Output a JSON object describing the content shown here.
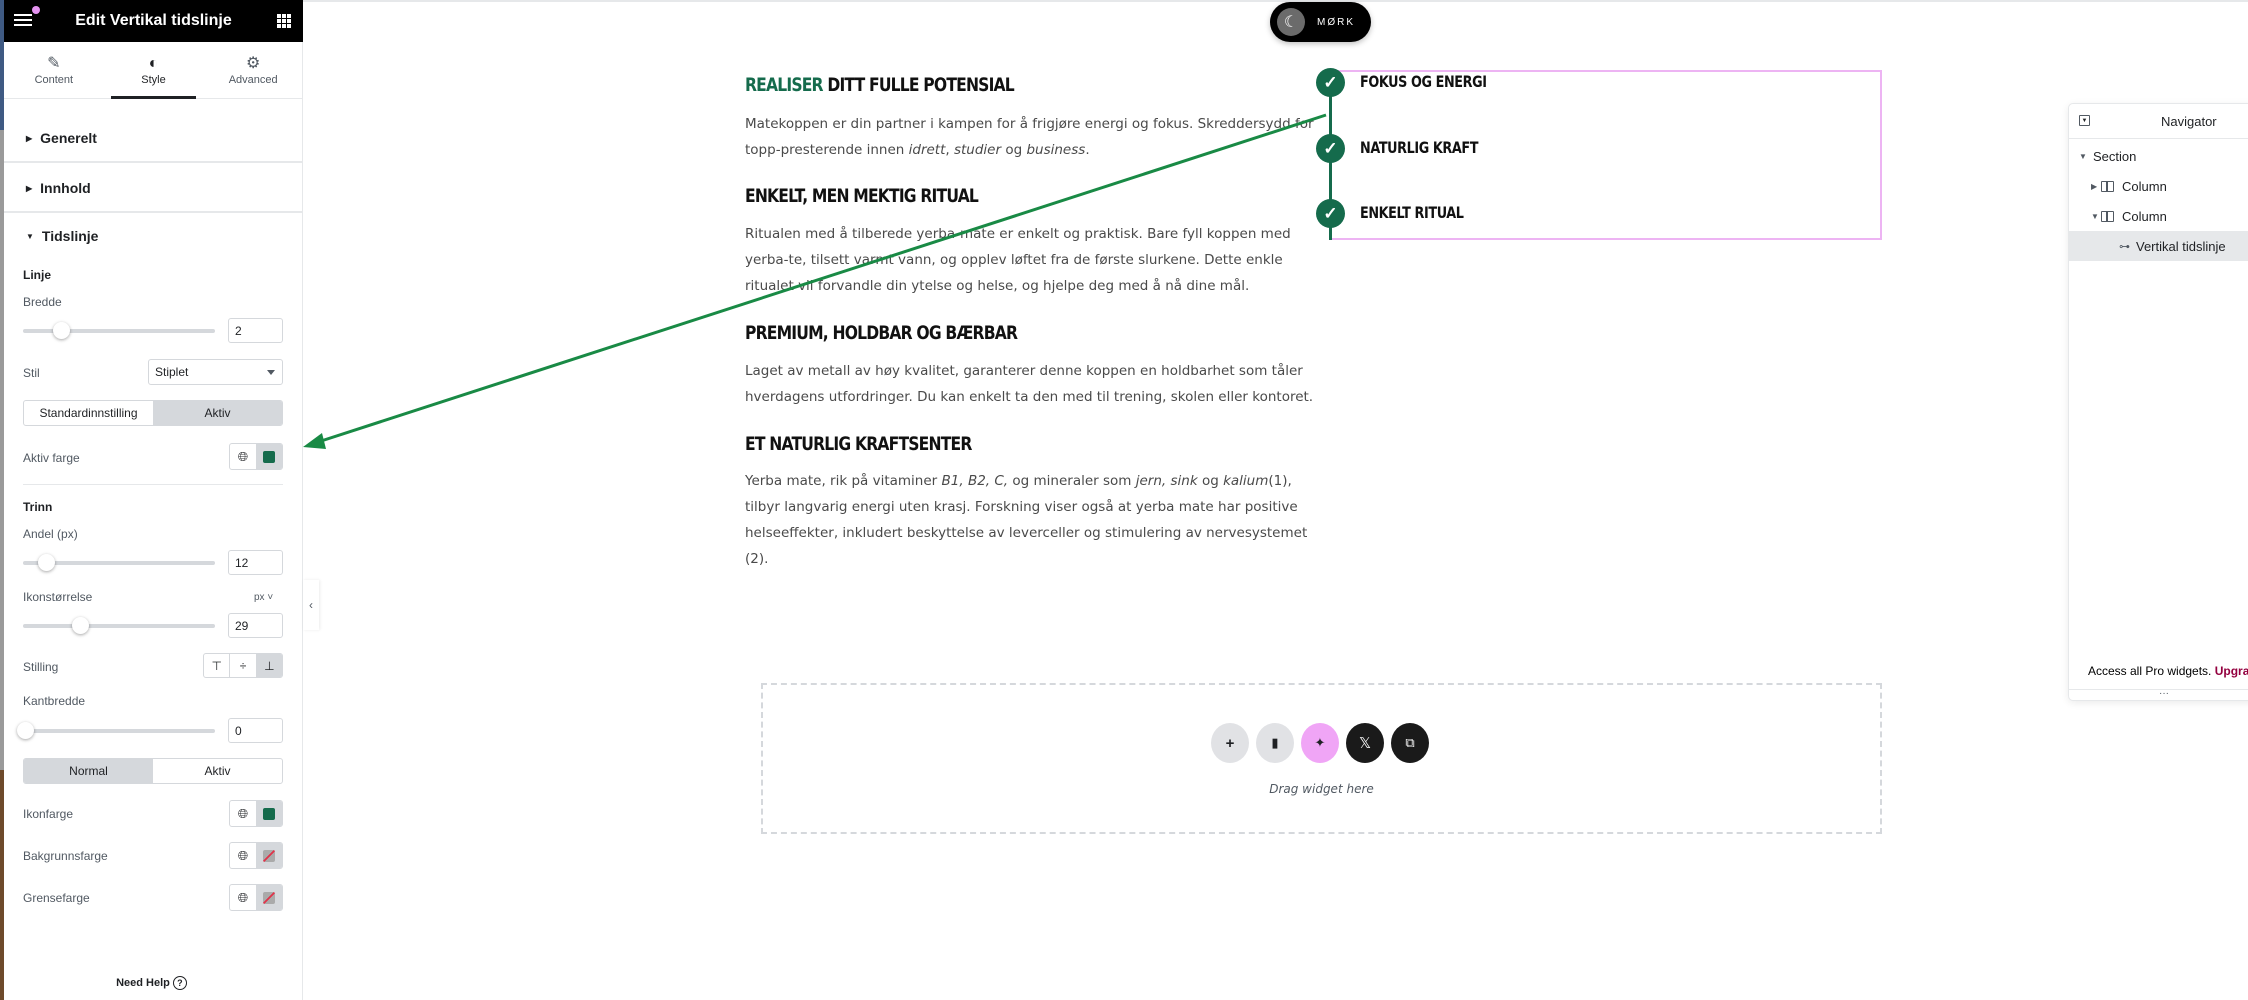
{
  "sidebar": {
    "title": "Edit Vertikal tidslinje",
    "tabs": [
      {
        "label": "Content",
        "icon": "pencil-icon"
      },
      {
        "label": "Style",
        "icon": "half-circle-icon"
      },
      {
        "label": "Advanced",
        "icon": "gear-icon"
      }
    ],
    "active_tab": "Style",
    "sections": [
      {
        "label": "Generelt",
        "expanded": false
      },
      {
        "label": "Innhold",
        "expanded": false
      },
      {
        "label": "Tidslinje",
        "expanded": true
      }
    ],
    "linje": {
      "heading": "Linje",
      "bredde_label": "Bredde",
      "bredde_value": "2",
      "stil_label": "Stil",
      "stil_value": "Stiplet",
      "state_tabs": [
        "Standardinnstilling",
        "Aktiv"
      ],
      "state_active": "Aktiv",
      "aktiv_farge_label": "Aktiv farge",
      "aktiv_farge": "#156b4c"
    },
    "trinn": {
      "heading": "Trinn",
      "andel_label": "Andel (px)",
      "andel_value": "12",
      "ikonstorrelse_label": "Ikonstørrelse",
      "ikonstorrelse_unit": "px",
      "ikonstorrelse_value": "29",
      "stilling_label": "Stilling",
      "stilling_options": [
        "top",
        "middle",
        "bottom"
      ],
      "stilling_selected": "bottom",
      "kantbredde_label": "Kantbredde",
      "kantbredde_value": "0",
      "state_tabs": [
        "Normal",
        "Aktiv"
      ],
      "state_active": "Normal",
      "ikonfarge_label": "Ikonfarge",
      "ikonfarge": "#156b4c",
      "bakgrunnsfarge_label": "Bakgrunnsfarge",
      "grensefarge_label": "Grensefarge"
    },
    "help_label": "Need Help"
  },
  "toggle": {
    "label": "MØRK"
  },
  "content": {
    "sections": [
      {
        "heading_accent": "REALISER",
        "heading_rest": " DITT FULLE POTENSIAL",
        "text_html": "Matekoppen er din partner i kampen for å frigjøre energi og fokus. Skreddersydd for topp-presterende innen <i>idrett</i>, <i>studier</i> og <i>business</i>."
      },
      {
        "heading_accent": "",
        "heading_rest": "ENKELT, MEN MEKTIG RITUAL",
        "text_html": "Ritualen med å tilberede yerba-mate er enkelt og praktisk. Bare fyll koppen med yerba-te, tilsett varmt vann, og opplev løftet fra de første slurkene. Dette enkle ritualet vil forvandle din ytelse og helse, og hjelpe deg med å nå dine mål."
      },
      {
        "heading_accent": "",
        "heading_rest": "PREMIUM, HOLDBAR OG BÆRBAR",
        "text_html": "Laget av metall av høy kvalitet, garanterer denne koppen en holdbarhet som tåler hverdagens utfordringer. Du kan enkelt ta den med til trening, skolen eller kontoret."
      },
      {
        "heading_accent": "",
        "heading_rest": "ET NATURLIG KRAFTSENTER",
        "text_html": "Yerba mate, rik på vitaminer <i>B1, B2, C,</i> og mineraler som <i>jern, sink</i> og <i>kalium</i>(1), tilbyr langvarig energi uten krasj. Forskning viser også at yerba mate har positive helseeffekter, inkludert beskyttelse av leverceller og stimulering av nervesystemet (2)."
      }
    ]
  },
  "timeline": {
    "items": [
      "FOKUS OG ENERGI",
      "NATURLIG KRAFT",
      "ENKELT RITUAL"
    ],
    "color": "#156b4c"
  },
  "navigator": {
    "title": "Navigator",
    "tree": [
      {
        "label": "Section",
        "level": 0,
        "expanded": true
      },
      {
        "label": "Column",
        "level": 1,
        "expanded": false
      },
      {
        "label": "Column",
        "level": 1,
        "expanded": true
      },
      {
        "label": "Vertikal tidslinje",
        "level": 2,
        "selected": true
      }
    ],
    "pro_text": "Access all Pro widgets.",
    "pro_link": "Upgrade"
  },
  "dropzone": {
    "text": "Drag widget here",
    "buttons": [
      "add-icon",
      "folder-icon",
      "ai-sparkle-icon",
      "x-logo-icon",
      "copy-icon"
    ]
  },
  "colors": {
    "accent": "#156b4c",
    "highlight": "#edb4f3",
    "pro": "#93003f"
  }
}
